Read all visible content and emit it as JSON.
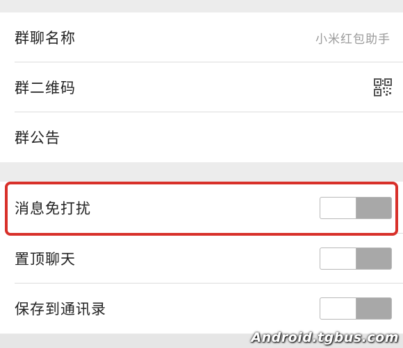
{
  "group_info": {
    "name_label": "群聊名称",
    "name_value": "小米红包助手",
    "qr_label": "群二维码",
    "announcement_label": "群公告"
  },
  "settings": {
    "mute_label": "消息免打扰",
    "mute_on": false,
    "pin_label": "置顶聊天",
    "pin_on": false,
    "save_label": "保存到通讯录",
    "save_on": false
  },
  "icons": {
    "qr": "qr-code-icon"
  },
  "colors": {
    "highlight": "#d8302a",
    "toggle_track": "#a8a8a8",
    "background": "#ececec"
  },
  "watermark": "Android.tgbus.com"
}
